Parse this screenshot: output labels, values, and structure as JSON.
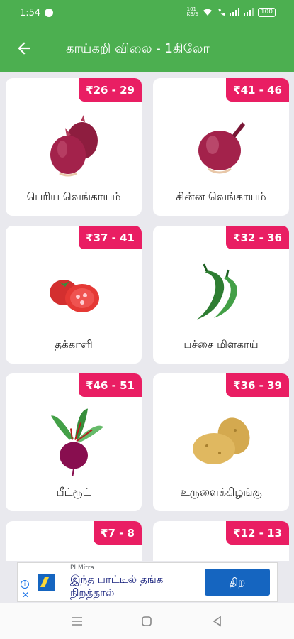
{
  "status_bar": {
    "time": "1:54",
    "right_text": "101\nKB/S",
    "battery": "100",
    "icons": [
      "notification-dot-icon",
      "wifi-icon",
      "call-icon",
      "signal-icon",
      "signal-icon",
      "battery-icon"
    ]
  },
  "app_bar": {
    "title": "காய்கறி விலை - 1கிலோ",
    "back_icon": "arrow-back-icon"
  },
  "items": [
    {
      "price": "₹26 - 29",
      "name": "பெரிய வெங்காயம்",
      "icon": "big-onion-icon"
    },
    {
      "price": "₹41 - 46",
      "name": "சின்ன வெங்காயம்",
      "icon": "small-onion-icon"
    },
    {
      "price": "₹37 - 41",
      "name": "தக்காளி",
      "icon": "tomato-icon"
    },
    {
      "price": "₹32 - 36",
      "name": "பச்சை மிளகாய்",
      "icon": "green-chilli-icon"
    },
    {
      "price": "₹46 - 51",
      "name": "பீட்ரூட்",
      "icon": "beetroot-icon"
    },
    {
      "price": "₹36 - 39",
      "name": "உருளைக்கிழங்கு",
      "icon": "potato-icon"
    },
    {
      "price": "₹7 - 8",
      "name": "",
      "icon": ""
    },
    {
      "price": "₹12 - 13",
      "name": "",
      "icon": ""
    }
  ],
  "ad": {
    "brand": "PI Mitra",
    "headline": "இந்த பாட்டில் தங்க நிறத்தால்",
    "cta": "திற",
    "accent": "#1565c0"
  },
  "colors": {
    "app_bar": "#4caf50",
    "price_badge": "#e91e63"
  },
  "nav_bar": {
    "icons": [
      "recent-apps-icon",
      "home-icon",
      "back-icon"
    ]
  }
}
